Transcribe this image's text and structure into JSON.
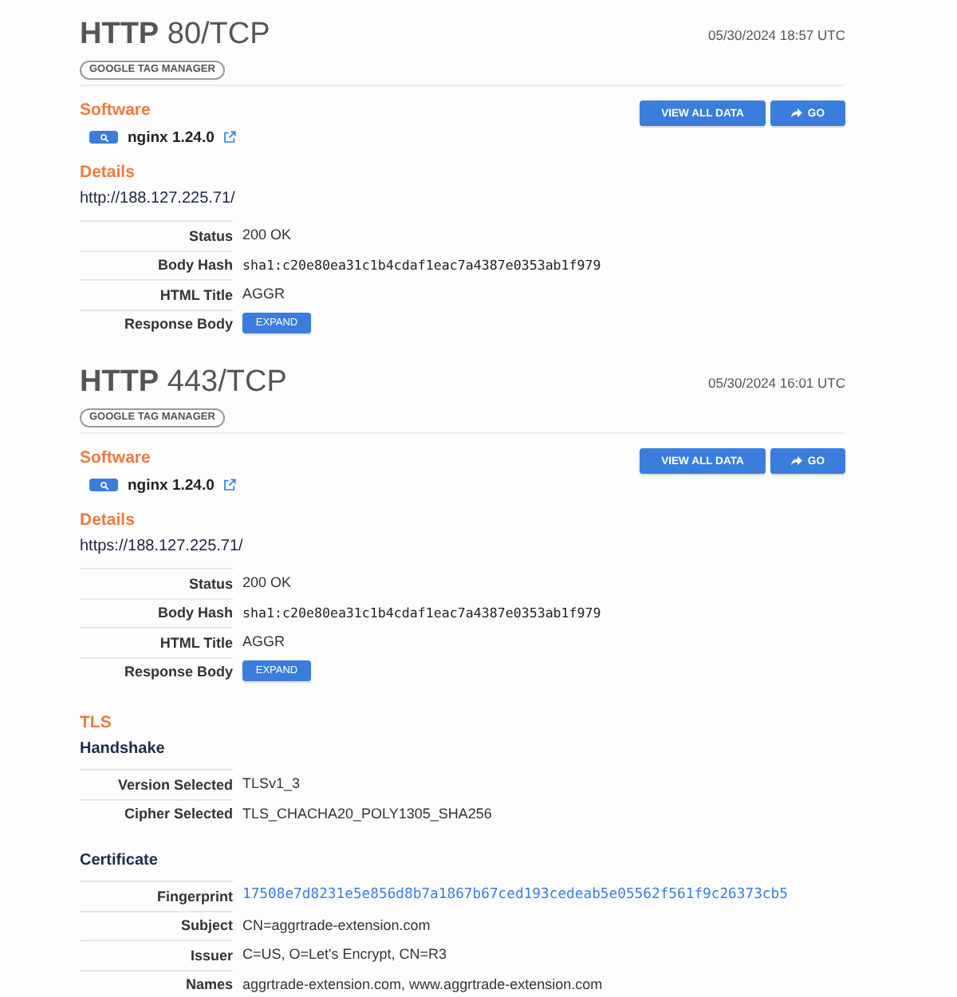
{
  "services": [
    {
      "title": "**HTTP** 80/TCP",
      "timestamp": "05/30/2024 18:57 UTC",
      "tags": [
        "GOOGLE TAG MANAGER"
      ],
      "software_heading": "Software",
      "buttons": [
        {
          "label": "VIEW ALL DATA",
          "kind": "plain"
        },
        {
          "label": "GO",
          "kind": "go"
        }
      ],
      "software": [
        {
          "name": "nginx 1.24.0"
        }
      ],
      "details_heading": "Details",
      "url": "http://188.127.225.71/",
      "fields": [
        {
          "label": "Status",
          "value": "200 OK",
          "kind": "text"
        },
        {
          "label": "Body Hash",
          "value": "sha1:c20e80ea31c1b4cdaf1eac7a4387e0353ab1f979",
          "kind": "mono"
        },
        {
          "label": "HTML Title",
          "value": "AGGR",
          "kind": "text"
        },
        {
          "label": "Response Body",
          "value": "EXPAND",
          "kind": "button"
        }
      ]
    },
    {
      "title": "**HTTP** 443/TCP",
      "timestamp": "05/30/2024 16:01 UTC",
      "tags": [
        "GOOGLE TAG MANAGER"
      ],
      "software_heading": "Software",
      "buttons": [
        {
          "label": "VIEW ALL DATA",
          "kind": "plain"
        },
        {
          "label": "GO",
          "kind": "go"
        }
      ],
      "software": [
        {
          "name": "nginx 1.24.0"
        }
      ],
      "details_heading": "Details",
      "url": "https://188.127.225.71/",
      "fields": [
        {
          "label": "Status",
          "value": "200 OK",
          "kind": "text"
        },
        {
          "label": "Body Hash",
          "value": "sha1:c20e80ea31c1b4cdaf1eac7a4387e0353ab1f979",
          "kind": "mono"
        },
        {
          "label": "HTML Title",
          "value": "AGGR",
          "kind": "text"
        },
        {
          "label": "Response Body",
          "value": "EXPAND",
          "kind": "button"
        }
      ]
    }
  ],
  "tls": {
    "heading": "TLS",
    "groups": [
      {
        "title": "Handshake",
        "fields": [
          {
            "label": "Version Selected",
            "value": "TLSv1_3",
            "kind": "text"
          },
          {
            "label": "Cipher Selected",
            "value": "TLS_CHACHA20_POLY1305_SHA256",
            "kind": "text"
          }
        ]
      },
      {
        "title": "Certificate",
        "fields": [
          {
            "label": "Fingerprint",
            "value": "17508e7d8231e5e856d8b7a1867b67ced193cedeab5e05562f561f9c26373cb5",
            "kind": "link"
          },
          {
            "label": "Subject",
            "value": "CN=aggrtrade-extension.com",
            "kind": "text"
          },
          {
            "label": "Issuer",
            "value": "C=US, O=Let's Encrypt, CN=R3",
            "kind": "text"
          },
          {
            "label": "Names",
            "value": "aggrtrade-extension.com, www.aggrtrade-extension.com",
            "kind": "text"
          }
        ]
      }
    ]
  }
}
